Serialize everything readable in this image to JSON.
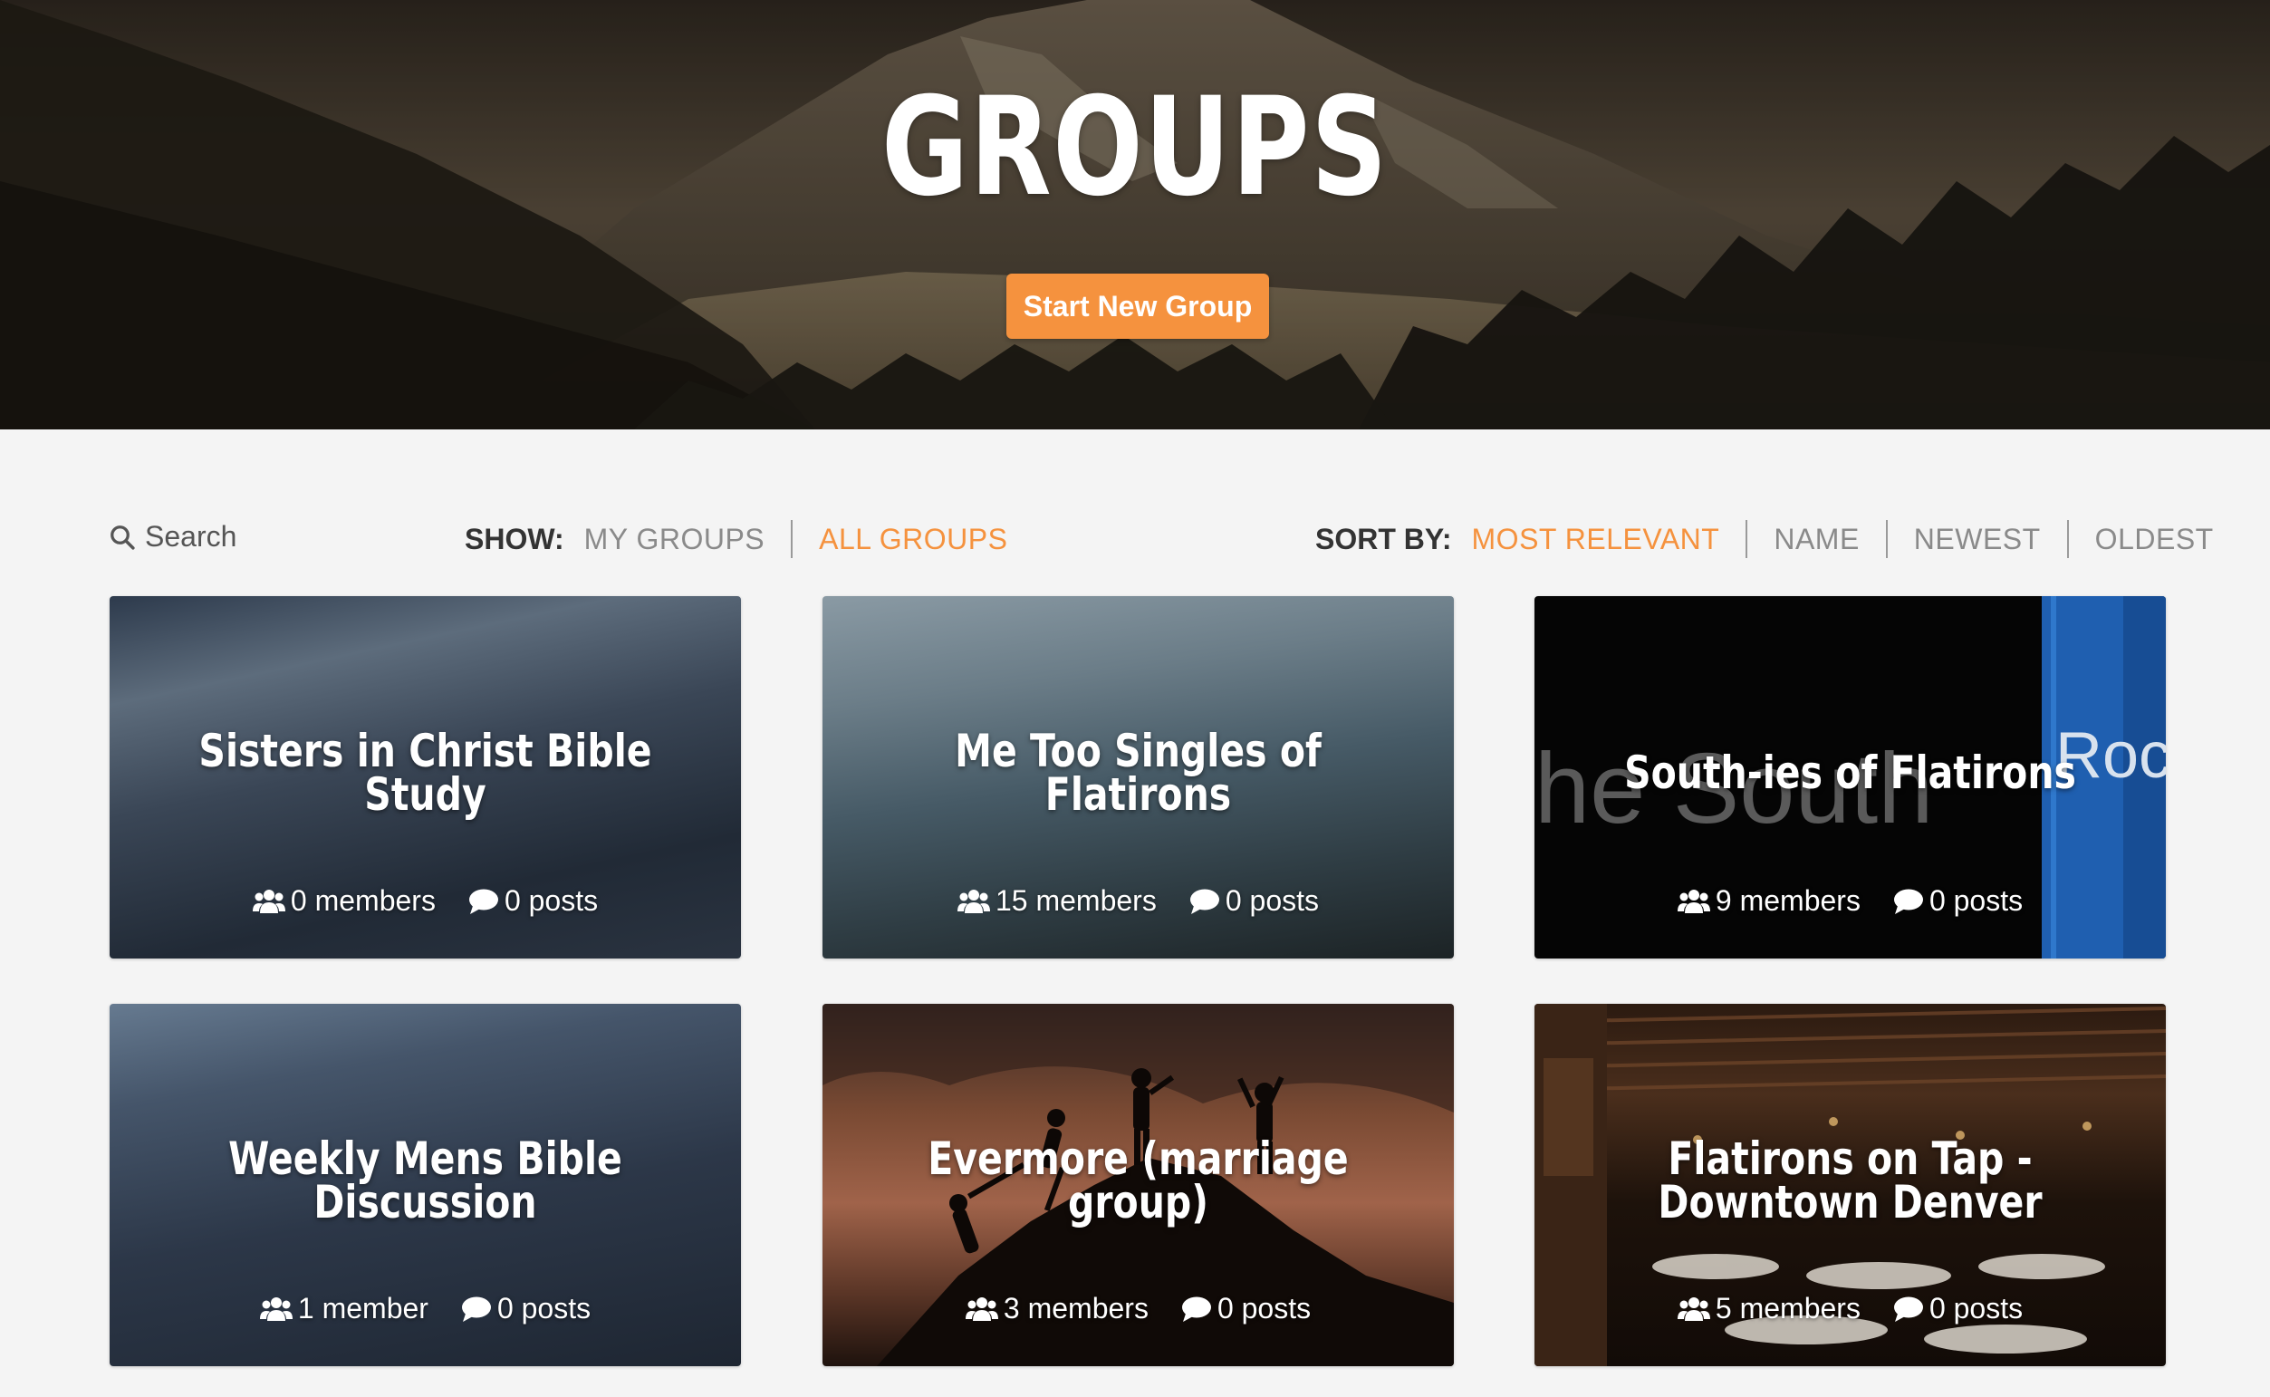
{
  "hero": {
    "title": "GROUPS",
    "start_button_label": "Start New Group"
  },
  "toolbar": {
    "search": {
      "placeholder": "Search",
      "icon": "search-icon"
    },
    "show": {
      "label": "SHOW:",
      "options": [
        "MY GROUPS",
        "ALL GROUPS"
      ],
      "selected": "ALL GROUPS"
    },
    "sort": {
      "label": "SORT BY:",
      "options": [
        "MOST RELEVANT",
        "NAME",
        "NEWEST",
        "OLDEST"
      ],
      "selected": "MOST RELEVANT"
    }
  },
  "colors": {
    "accent": "#f5923e",
    "page_background": "#f4f4f4",
    "inactive_option": "#8a8a8a"
  },
  "groups": [
    {
      "title": "Sisters in Christ Bible Study",
      "members": "0 members",
      "posts": "0 posts"
    },
    {
      "title": "Me Too Singles of Flatirons",
      "members": "15 members",
      "posts": "0 posts"
    },
    {
      "title": "South-ies of Flatirons",
      "members": "9 members",
      "posts": "0 posts",
      "background_text": [
        "he South",
        "Roc"
      ]
    },
    {
      "title": "Weekly Mens Bible Discussion",
      "members": "1 member",
      "posts": "0 posts"
    },
    {
      "title": "Evermore (marriage group)",
      "members": "3 members",
      "posts": "0 posts"
    },
    {
      "title": "Flatirons on Tap - Downtown Denver",
      "members": "5 members",
      "posts": "0 posts"
    }
  ]
}
